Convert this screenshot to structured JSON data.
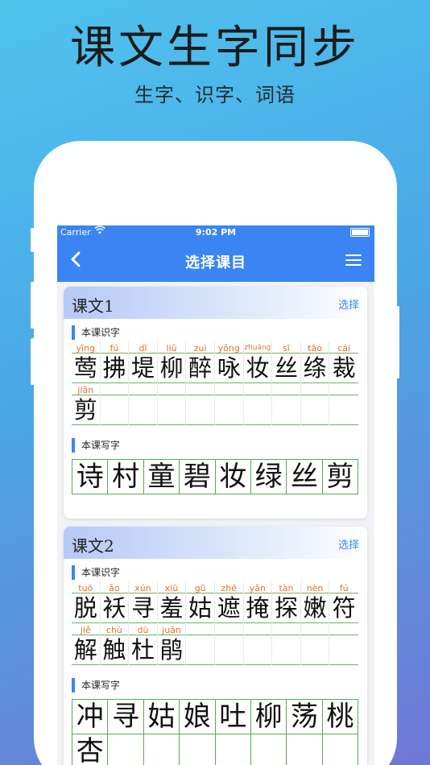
{
  "hero": {
    "title": "课文生字同步",
    "subtitle": "生字、识字、词语"
  },
  "status_bar": {
    "carrier": "Carrier",
    "time": "9:02 PM"
  },
  "nav": {
    "title": "选择课目"
  },
  "lessons": [
    {
      "title": "课文1",
      "select_label": "选择",
      "recognize_label": "本课识字",
      "recognize_rows": [
        [
          {
            "py": "yīng",
            "hz": "莺"
          },
          {
            "py": "fú",
            "hz": "拂"
          },
          {
            "py": "dī",
            "hz": "堤"
          },
          {
            "py": "liǔ",
            "hz": "柳"
          },
          {
            "py": "zuì",
            "hz": "醉"
          },
          {
            "py": "yǒng",
            "hz": "咏"
          },
          {
            "py": "zhuāng",
            "hz": "妆"
          },
          {
            "py": "sī",
            "hz": "丝"
          },
          {
            "py": "tāo",
            "hz": "绦"
          },
          {
            "py": "cái",
            "hz": "裁"
          }
        ],
        [
          {
            "py": "jiǎn",
            "hz": "剪"
          },
          {
            "py": "",
            "hz": ""
          },
          {
            "py": "",
            "hz": ""
          },
          {
            "py": "",
            "hz": ""
          },
          {
            "py": "",
            "hz": ""
          },
          {
            "py": "",
            "hz": ""
          },
          {
            "py": "",
            "hz": ""
          },
          {
            "py": "",
            "hz": ""
          },
          {
            "py": "",
            "hz": ""
          },
          {
            "py": "",
            "hz": ""
          }
        ]
      ],
      "write_label": "本课写字",
      "write_chars": [
        "诗",
        "村",
        "童",
        "碧",
        "妆",
        "绿",
        "丝",
        "剪"
      ]
    },
    {
      "title": "课文2",
      "select_label": "选择",
      "recognize_label": "本课识字",
      "recognize_rows": [
        [
          {
            "py": "tuō",
            "hz": "脱"
          },
          {
            "py": "ǎo",
            "hz": "袄"
          },
          {
            "py": "xún",
            "hz": "寻"
          },
          {
            "py": "xiū",
            "hz": "羞"
          },
          {
            "py": "gū",
            "hz": "姑"
          },
          {
            "py": "zhē",
            "hz": "遮"
          },
          {
            "py": "yǎn",
            "hz": "掩"
          },
          {
            "py": "tàn",
            "hz": "探"
          },
          {
            "py": "nèn",
            "hz": "嫩"
          },
          {
            "py": "fú",
            "hz": "符"
          }
        ],
        [
          {
            "py": "jiě",
            "hz": "解"
          },
          {
            "py": "chù",
            "hz": "触"
          },
          {
            "py": "dù",
            "hz": "杜"
          },
          {
            "py": "juān",
            "hz": "鹃"
          },
          {
            "py": "",
            "hz": ""
          },
          {
            "py": "",
            "hz": ""
          },
          {
            "py": "",
            "hz": ""
          },
          {
            "py": "",
            "hz": ""
          },
          {
            "py": "",
            "hz": ""
          },
          {
            "py": "",
            "hz": ""
          }
        ]
      ],
      "write_label": "本课写字",
      "write_chars": [
        "冲",
        "寻",
        "姑",
        "娘",
        "吐",
        "柳",
        "荡",
        "桃"
      ],
      "write_chars_row2": [
        "杏",
        "",
        "",
        "",
        "",
        "",
        "",
        ""
      ]
    }
  ]
}
